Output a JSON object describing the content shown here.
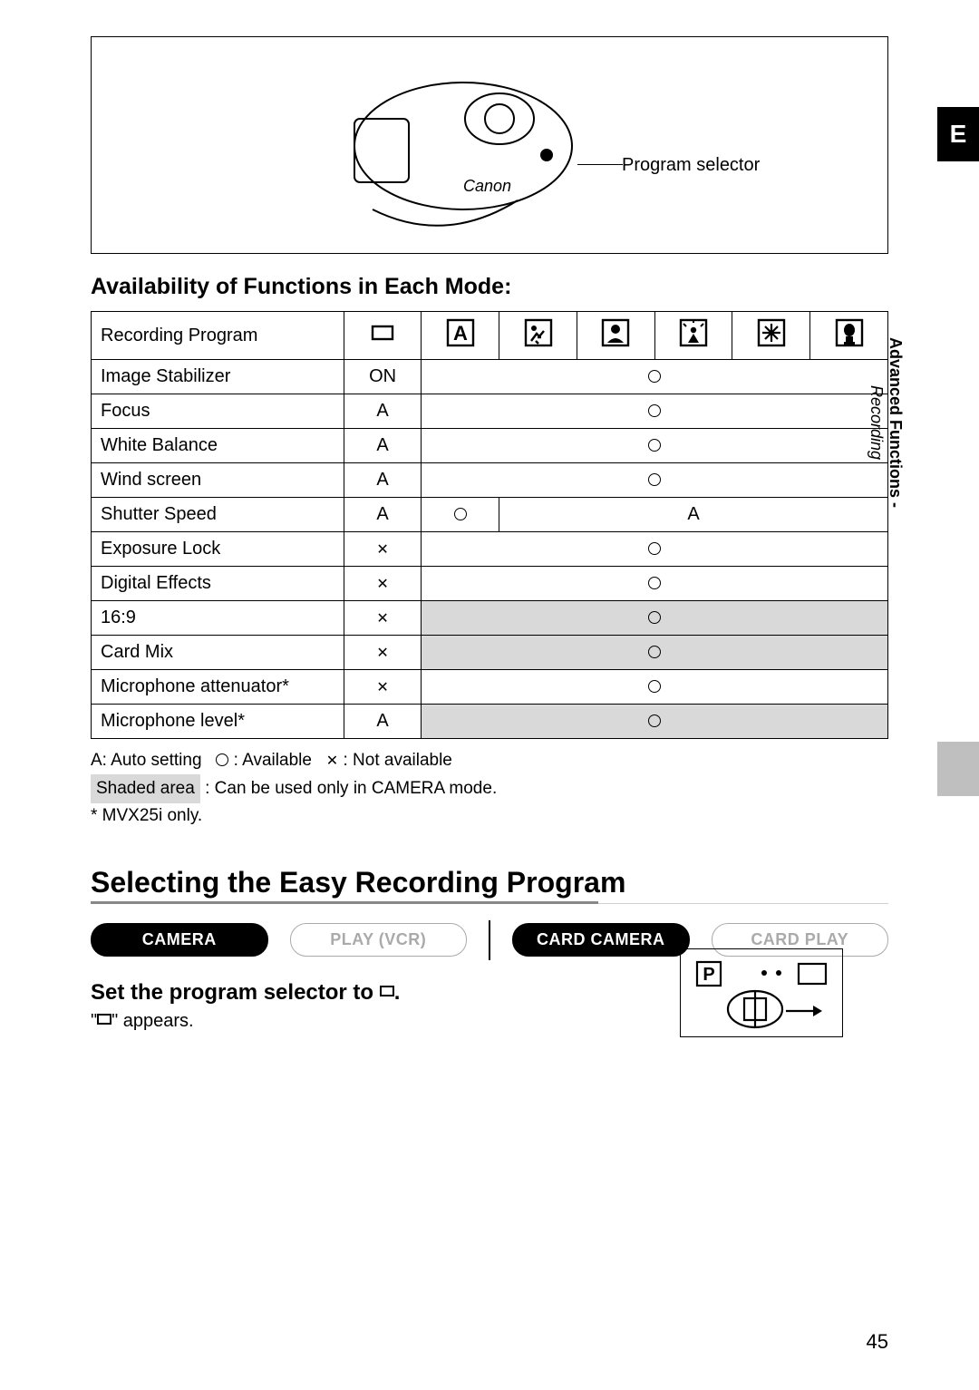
{
  "side": {
    "main": "Advanced Functions",
    "sub": "Recording"
  },
  "tab_letter": "E",
  "image": {
    "callout": "Program selector"
  },
  "subhead": "Availability of Functions in Each Mode:",
  "table": {
    "header_label": "Recording Program",
    "mode_icons": [
      "easy",
      "auto",
      "sports",
      "portrait",
      "spotlight",
      "sand-snow",
      "low-light"
    ],
    "rows": [
      {
        "label": "Image Stabilizer",
        "col1": "ON",
        "merged": "○",
        "shaded": false
      },
      {
        "label": "Focus",
        "col1": "A",
        "merged": "○",
        "shaded": false
      },
      {
        "label": "White Balance",
        "col1": "A",
        "merged": "○",
        "shaded": false
      },
      {
        "label": "Wind screen",
        "col1": "A",
        "merged": "○",
        "shaded": false
      },
      {
        "label": "Shutter Speed",
        "col1": "A",
        "col2": "○",
        "rest": "A",
        "shaded": false
      },
      {
        "label": "Exposure Lock",
        "col1": "✕",
        "merged": "○",
        "shaded": false
      },
      {
        "label": "Digital Effects",
        "col1": "✕",
        "merged": "○",
        "shaded": false
      },
      {
        "label": "16:9",
        "col1": "✕",
        "merged": "○",
        "shaded": true
      },
      {
        "label": "Card Mix",
        "col1": "✕",
        "merged": "○",
        "shaded": true
      },
      {
        "label": "Microphone attenuator*",
        "col1": "✕",
        "merged": "○",
        "shaded": false
      },
      {
        "label": "Microphone level*",
        "col1": "A",
        "merged": "○",
        "shaded": true
      }
    ]
  },
  "legend": {
    "line1_a": "A: Auto setting",
    "line1_circle": ": Available",
    "line1_x": ": Not available",
    "line2_box": "Shaded area",
    "line2_rest": ": Can be used only in CAMERA mode.",
    "line3": "* MVX25i only."
  },
  "section_title": "Selecting the Easy Recording Program",
  "modes": [
    {
      "label": "CAMERA",
      "state": "active"
    },
    {
      "label": "PLAY (VCR)",
      "state": "inactive"
    },
    {
      "label": "CARD CAMERA",
      "state": "active"
    },
    {
      "label": "CARD PLAY",
      "state": "inactive"
    }
  ],
  "step": {
    "head_pre": "Set the program selector to ",
    "head_post": ".",
    "note_pre": "\"",
    "note_post": "\" appears."
  },
  "page_number": "45"
}
